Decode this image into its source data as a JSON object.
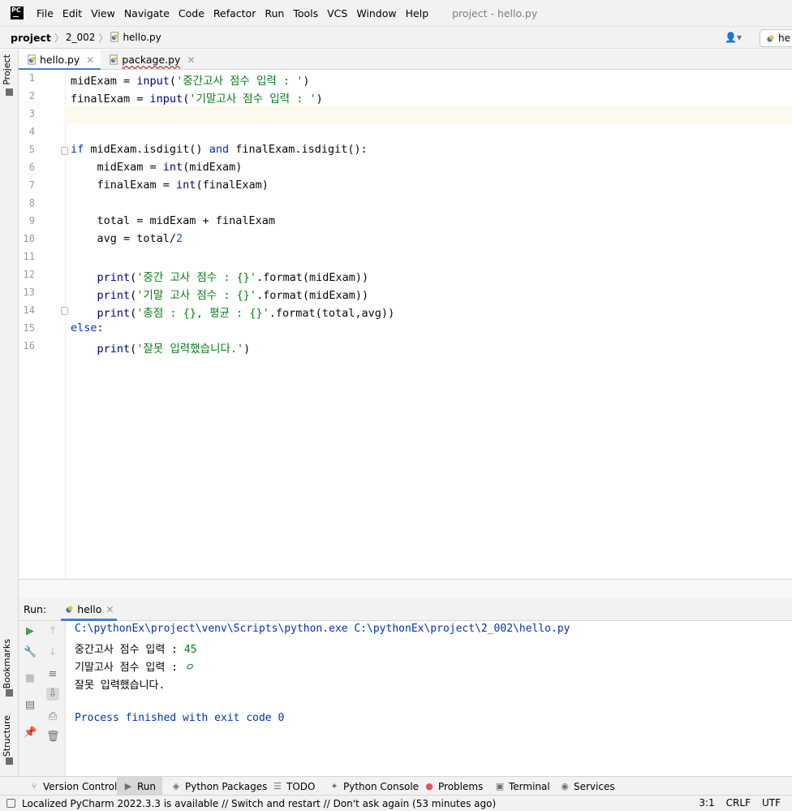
{
  "app": {
    "logo_text": "PC",
    "window_title": "project - hello.py",
    "menu": [
      "File",
      "Edit",
      "View",
      "Navigate",
      "Code",
      "Refactor",
      "Run",
      "Tools",
      "VCS",
      "Window",
      "Help"
    ]
  },
  "navbar": {
    "crumbs": [
      "project",
      "2_002",
      "hello.py"
    ],
    "run_config": "he"
  },
  "left_strip": {
    "project": "Project",
    "bookmarks": "Bookmarks",
    "structure": "Structure"
  },
  "editor": {
    "tabs": [
      {
        "label": "hello.py",
        "active": true
      },
      {
        "label": "package.py",
        "active": false
      }
    ],
    "line_numbers": [
      "1",
      "2",
      "3",
      "4",
      "5",
      "6",
      "7",
      "8",
      "9",
      "10",
      "11",
      "12",
      "13",
      "14",
      "15",
      "16"
    ],
    "lines": [
      [
        {
          "t": "midExam = ",
          "c": ""
        },
        {
          "t": "input",
          "c": "fn"
        },
        {
          "t": "(",
          "c": ""
        },
        {
          "t": "'중간고사 점수 입력 : '",
          "c": "str"
        },
        {
          "t": ")",
          "c": ""
        }
      ],
      [
        {
          "t": "finalExam = ",
          "c": ""
        },
        {
          "t": "input",
          "c": "fn"
        },
        {
          "t": "(",
          "c": ""
        },
        {
          "t": "'기말고사 점수 입력 : '",
          "c": "str"
        },
        {
          "t": ")",
          "c": ""
        }
      ],
      [],
      [],
      [
        {
          "t": "if ",
          "c": "kw"
        },
        {
          "t": "midExam.isdigit() ",
          "c": ""
        },
        {
          "t": "and ",
          "c": "kw"
        },
        {
          "t": "finalExam.isdigit():",
          "c": ""
        }
      ],
      [
        {
          "t": "    midExam = ",
          "c": ""
        },
        {
          "t": "int",
          "c": "fn"
        },
        {
          "t": "(midExam)",
          "c": ""
        }
      ],
      [
        {
          "t": "    finalExam = ",
          "c": ""
        },
        {
          "t": "int",
          "c": "fn"
        },
        {
          "t": "(finalExam)",
          "c": ""
        }
      ],
      [],
      [
        {
          "t": "    total = midExam + finalExam",
          "c": ""
        }
      ],
      [
        {
          "t": "    avg = total/",
          "c": ""
        },
        {
          "t": "2",
          "c": "num"
        }
      ],
      [],
      [
        {
          "t": "    ",
          "c": ""
        },
        {
          "t": "print",
          "c": "fn"
        },
        {
          "t": "(",
          "c": ""
        },
        {
          "t": "'중간 고사 점수 : {}'",
          "c": "str"
        },
        {
          "t": ".format(midExam))",
          "c": ""
        }
      ],
      [
        {
          "t": "    ",
          "c": ""
        },
        {
          "t": "print",
          "c": "fn"
        },
        {
          "t": "(",
          "c": ""
        },
        {
          "t": "'기말 고사 점수 : {}'",
          "c": "str"
        },
        {
          "t": ".format(midExam))",
          "c": ""
        }
      ],
      [
        {
          "t": "    ",
          "c": ""
        },
        {
          "t": "print",
          "c": "fn"
        },
        {
          "t": "(",
          "c": ""
        },
        {
          "t": "'총점 : {}, 평균 : {}'",
          "c": "str"
        },
        {
          "t": ".format(total,avg))",
          "c": ""
        }
      ],
      [
        {
          "t": "else",
          "c": "kw"
        },
        {
          "t": ":",
          "c": ""
        }
      ],
      [
        {
          "t": "    ",
          "c": ""
        },
        {
          "t": "print",
          "c": "fn"
        },
        {
          "t": "(",
          "c": ""
        },
        {
          "t": "'잘못 입력했습니다.'",
          "c": "str"
        },
        {
          "t": ")",
          "c": ""
        }
      ]
    ]
  },
  "run": {
    "label": "Run:",
    "tab": "hello",
    "console": {
      "command": "C:\\pythonEx\\project\\venv\\Scripts\\python.exe C:\\pythonEx\\project\\2_002\\hello.py",
      "prompt1": "중간고사 점수 입력 : ",
      "input1": "45",
      "prompt2": "기말고사 점수 입력 : ",
      "input2": "ㅇ",
      "output": "잘못 입력했습니다.",
      "exit": "Process finished with exit code 0"
    }
  },
  "bottom_tools": [
    {
      "label": "Version Control",
      "icon": "branch-icon",
      "glyph": "⑂",
      "active": false
    },
    {
      "label": "Run",
      "icon": "run-icon",
      "glyph": "▶",
      "active": true
    },
    {
      "label": "Python Packages",
      "icon": "packages-icon",
      "glyph": "◈",
      "active": false
    },
    {
      "label": "TODO",
      "icon": "todo-icon",
      "glyph": "☰",
      "active": false
    },
    {
      "label": "Python Console",
      "icon": "python-console-icon",
      "glyph": "✦",
      "active": false
    },
    {
      "label": "Problems",
      "icon": "problems-icon",
      "glyph": "●",
      "active": false
    },
    {
      "label": "Terminal",
      "icon": "terminal-icon",
      "glyph": "▣",
      "active": false
    },
    {
      "label": "Services",
      "icon": "services-icon",
      "glyph": "◉",
      "active": false
    }
  ],
  "status": {
    "message": "Localized PyCharm 2022.3.3 is available // Switch and restart // Don't ask again (53 minutes ago)",
    "position": "3:1",
    "line_sep": "CRLF",
    "encoding": "UTF"
  },
  "colors": {
    "keyword": "#0033b3",
    "string": "#067d17",
    "number": "#1750eb",
    "accent": "#4083c9",
    "run_green": "#499c54",
    "error_red": "#db5860"
  }
}
